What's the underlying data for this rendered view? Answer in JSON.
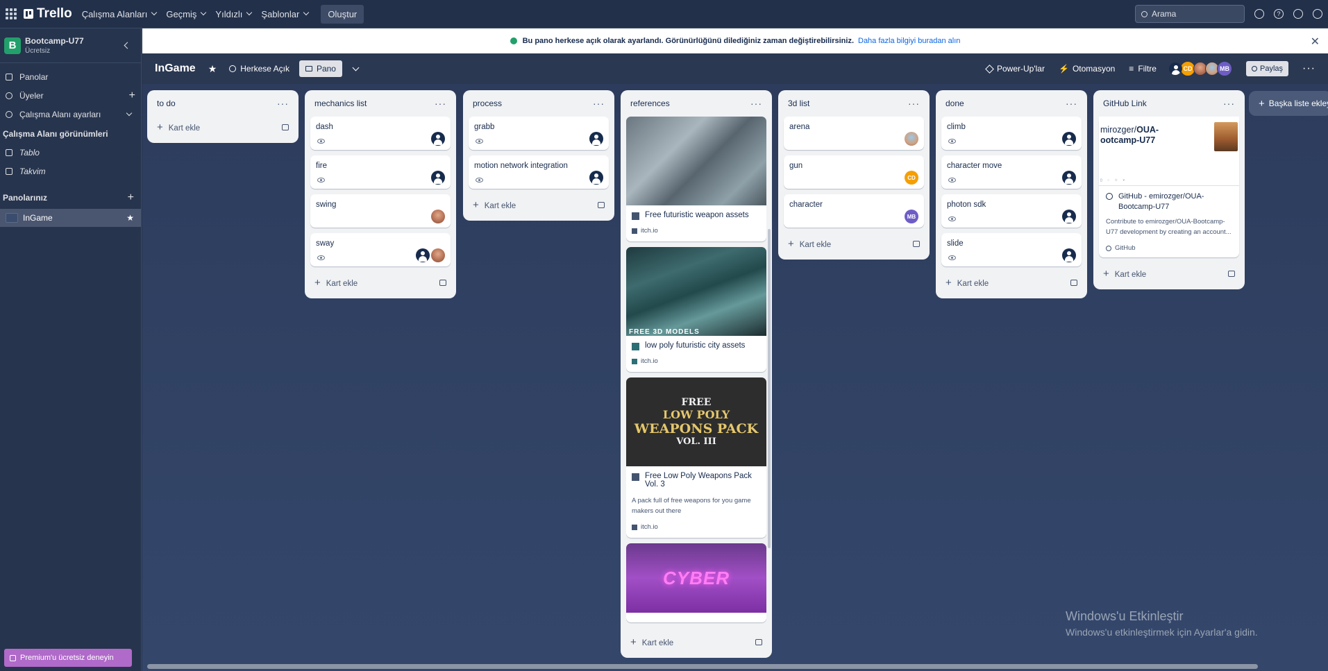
{
  "topbar": {
    "logo": "Trello",
    "nav": [
      "Çalışma Alanları",
      "Geçmiş",
      "Yıldızlı",
      "Şablonlar"
    ],
    "create_label": "Oluştur",
    "search_placeholder": "Arama"
  },
  "sidebar": {
    "workspace_name": "Bootcamp-U77",
    "workspace_initial": "B",
    "workspace_plan": "Ücretsiz",
    "items": [
      {
        "label": "Panolar"
      },
      {
        "label": "Üyeler"
      },
      {
        "label": "Çalışma Alanı ayarları"
      }
    ],
    "views_heading": "Çalışma Alanı görünümleri",
    "views": [
      {
        "label": "Tablo"
      },
      {
        "label": "Takvim"
      }
    ],
    "boards_heading": "Panolarınız",
    "boards": [
      {
        "label": "InGame"
      }
    ],
    "premium_label": "Premium'u ücretsiz deneyin"
  },
  "notice": {
    "text": "Bu pano herkese açık olarak ayarlandı. Görünürlüğünü dilediğiniz zaman değiştirebilirsiniz.",
    "link": "Daha fazla bilgiyi buradan alın"
  },
  "board": {
    "title": "InGame",
    "visibility": "Herkese Açık",
    "view": "Pano",
    "powerups": "Power-Up'lar",
    "automation": "Otomasyon",
    "filter": "Filtre",
    "members": [
      "CD",
      "MB"
    ],
    "share": "Paylaş"
  },
  "add_card_label": "Kart ekle",
  "add_list_label": "Başka liste ekleyin",
  "lists": [
    {
      "title": "to do",
      "cards": []
    },
    {
      "title": "mechanics list",
      "cards": [
        {
          "title": "dash"
        },
        {
          "title": "fire"
        },
        {
          "title": "swing"
        },
        {
          "title": "sway"
        }
      ]
    },
    {
      "title": "process",
      "cards": [
        {
          "title": "grabb"
        },
        {
          "title": "motion network integration"
        }
      ]
    },
    {
      "title": "references",
      "cards": [
        {
          "title": "Free futuristic weapon assets",
          "source": "itch.io"
        },
        {
          "title": "low poly futuristic city assets",
          "source": "itch.io",
          "cover_stamp": "FREE 3D MODELS"
        },
        {
          "title": "Free Low Poly Weapons Pack Vol. 3",
          "description": "A pack full of free weapons for you game makers out there",
          "source": "itch.io",
          "cover_lines": [
            "FREE",
            "LOW POLY",
            "WEAPONS PACK",
            "VOL. III"
          ]
        },
        {
          "cover_text": "CYBER"
        }
      ]
    },
    {
      "title": "3d list",
      "cards": [
        {
          "title": "arena"
        },
        {
          "title": "gun",
          "member": "CD"
        },
        {
          "title": "character",
          "member": "MB"
        }
      ]
    },
    {
      "title": "done",
      "cards": [
        {
          "title": "climb"
        },
        {
          "title": "character move"
        },
        {
          "title": "photon sdk"
        },
        {
          "title": "slide"
        }
      ]
    },
    {
      "title": "GitHub Link",
      "cards": [
        {
          "preview_user": "mirozger/",
          "preview_repo": "OUA-",
          "preview_repo2": "ootcamp-U77",
          "title": "GitHub - emirozger/OUA-Bootcamp-U77",
          "description": "Contribute to emirozger/OUA-Bootcamp-U77 development by creating an account...",
          "source": "GitHub"
        }
      ]
    }
  ],
  "windows": {
    "line1": "Windows'u Etkinleştir",
    "line2": "Windows'u etkinleştirmek için Ayarlar'a gidin."
  }
}
